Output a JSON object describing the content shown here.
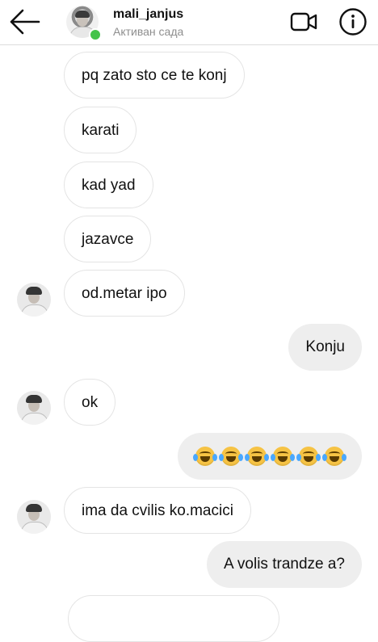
{
  "header": {
    "username": "mali_janjus",
    "status": "Активан сада",
    "icons": {
      "back": "back-arrow-icon",
      "video": "video-call-icon",
      "info": "info-icon"
    },
    "online_color": "#44c34a"
  },
  "messages": [
    {
      "sender": "them",
      "text": "pq zato sto ce te konj",
      "avatar": false
    },
    {
      "sender": "them",
      "text": "karati",
      "avatar": false
    },
    {
      "sender": "them",
      "text": "kad yad",
      "avatar": false
    },
    {
      "sender": "them",
      "text": "jazavce",
      "avatar": false
    },
    {
      "sender": "them",
      "text": "od.metar ipo",
      "avatar": true
    },
    {
      "sender": "me",
      "text": "Konju"
    },
    {
      "sender": "them",
      "text": "ok",
      "avatar": true
    },
    {
      "sender": "me",
      "emoji": "face-with-tears-of-joy",
      "count": 6
    },
    {
      "sender": "them",
      "text": "ima da cvilis ko.macici",
      "avatar": true
    },
    {
      "sender": "me",
      "text": "A volis trandze a?"
    }
  ]
}
